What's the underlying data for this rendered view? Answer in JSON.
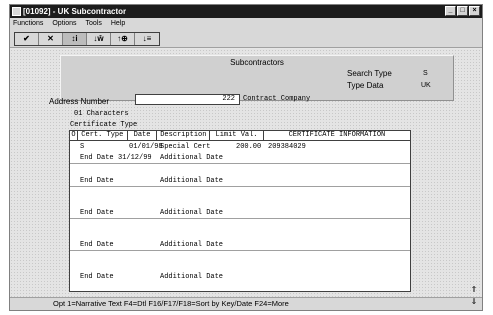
{
  "window": {
    "title": "[01092] - UK Subcontractor"
  },
  "menu": [
    "Functions",
    "Options",
    "Tools",
    "Help"
  ],
  "toolbar": {
    "buttons": [
      {
        "glyph": "✔",
        "name": "ok"
      },
      {
        "glyph": "✕",
        "name": "cancel"
      },
      {
        "glyph": "↕i",
        "name": "inquire"
      },
      {
        "glyph": "↓ŵ",
        "name": "add"
      },
      {
        "glyph": "↑⊕",
        "name": "change"
      },
      {
        "glyph": "↓≡",
        "name": "delete"
      }
    ]
  },
  "header": {
    "title": "Subcontractors",
    "search_type_label": "Search Type",
    "search_type_value": "S",
    "type_data_label": "Type Data",
    "type_data_value": "UK"
  },
  "address": {
    "label": "Address Number",
    "value": "222",
    "description": "Contract Company"
  },
  "characters_label": "01 Characters",
  "certificate_type_label": "Certificate Type",
  "grid": {
    "columns": [
      "O",
      "Cert. Type",
      "Date",
      "Description",
      "Limit Val.",
      "CERTIFICATE INFORMATION"
    ],
    "rows": [
      {
        "o": "",
        "cert_type": "S",
        "date": "01/01/98",
        "description": "Special Cert",
        "limit": "200.00",
        "info": "209384029",
        "end_date_label": "End Date",
        "end_date": "31/12/99",
        "additional": "Additional Date"
      },
      {
        "o": "",
        "cert_type": "",
        "date": "",
        "description": "",
        "limit": "",
        "info": "",
        "end_date_label": "End Date",
        "end_date": "",
        "additional": "Additional Date"
      },
      {
        "o": "",
        "cert_type": "",
        "date": "",
        "description": "",
        "limit": "",
        "info": "",
        "end_date_label": "End Date",
        "end_date": "",
        "additional": "Additional Date"
      },
      {
        "o": "",
        "cert_type": "",
        "date": "",
        "description": "",
        "limit": "",
        "info": "",
        "end_date_label": "End Date",
        "end_date": "",
        "additional": "Additional Date"
      },
      {
        "o": "",
        "cert_type": "",
        "date": "",
        "description": "",
        "limit": "",
        "info": "",
        "end_date_label": "End Date",
        "end_date": "",
        "additional": "Additional Date"
      }
    ]
  },
  "status": {
    "text": "Opt  1=Narrative Text  F4=Dtl  F16/F17/F18=Sort by Key/Date  F24=More"
  }
}
